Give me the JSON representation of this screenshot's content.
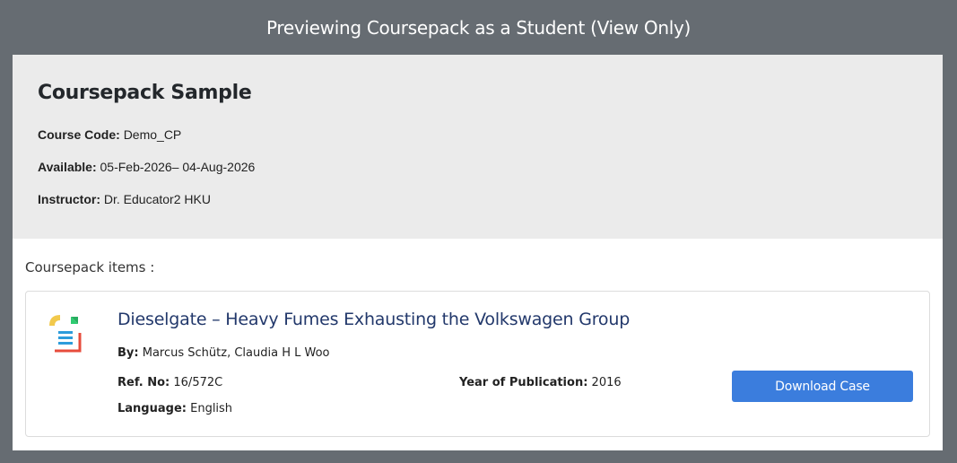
{
  "banner": {
    "text": "Previewing Coursepack as a Student (View Only)"
  },
  "coursepack": {
    "title": "Coursepack Sample",
    "course_code_label": "Course Code:",
    "course_code": "Demo_CP",
    "available_label": "Available:",
    "available": "05-Feb-2026– 04-Aug-2026",
    "instructor_label": "Instructor:",
    "instructor": "Dr. Educator2 HKU"
  },
  "items_label": "Coursepack items :",
  "items": [
    {
      "icon": "document-icon",
      "title": "Dieselgate – Heavy Fumes Exhausting the Volkswagen Group",
      "by_label": "By:",
      "by": "Marcus Schütz, Claudia H L Woo",
      "ref_label": "Ref. No:",
      "ref": "16/572C",
      "year_label": "Year of Publication:",
      "year": "2016",
      "language_label": "Language:",
      "language": "English",
      "download_label": "Download Case"
    }
  ],
  "colors": {
    "banner_bg": "#666c72",
    "info_bg": "#ebebeb",
    "link": "#22386b",
    "button": "#3b7ddd"
  }
}
